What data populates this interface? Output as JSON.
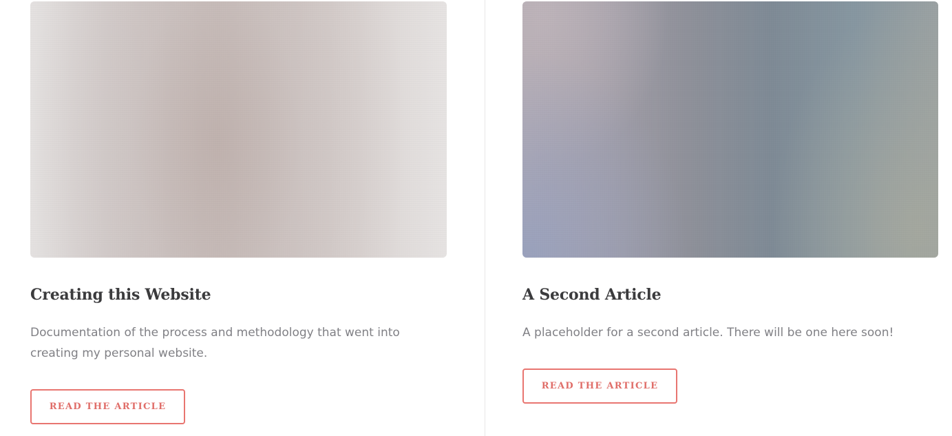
{
  "articles": [
    {
      "title": "Creating this Website",
      "description": "Documentation of the process and methodology that went into creating my personal website.",
      "button_label": "READ THE ARTICLE"
    },
    {
      "title": "A Second Article",
      "description": "A placeholder for a second article. There will be one here soon!",
      "button_label": "READ THE ARTICLE"
    }
  ],
  "colors": {
    "accent": "#e87570",
    "title_text": "#3b3b3d",
    "body_text": "#808085",
    "divider": "#e8e6e6"
  }
}
